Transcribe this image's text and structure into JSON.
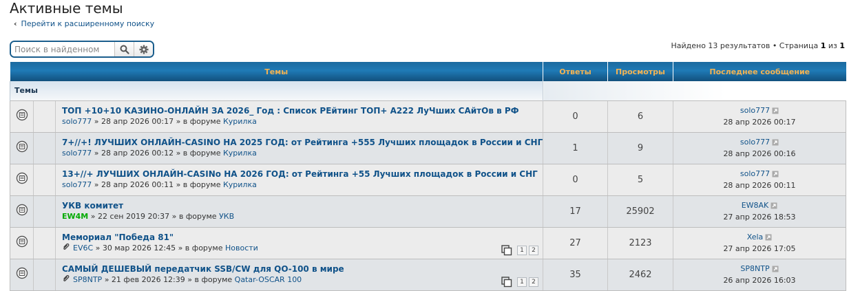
{
  "page": {
    "title": "Активные темы",
    "back_link": "Перейти к расширенному поиску",
    "search_placeholder": "Поиск в найденном",
    "results_prefix": "Найдено 13 результатов • Страница ",
    "page_current": "1",
    "page_of": " из ",
    "page_total": "1"
  },
  "table": {
    "headers": {
      "topics": "Темы",
      "replies": "Ответы",
      "views": "Просмотры",
      "last_post": "Последнее сообщение"
    },
    "group_label": "Темы",
    "rows": [
      {
        "title": "ТОП +10+10 КАЗИНО-ОНЛАЙН ЗА 2026_ Год : Список РЕйтинг ТОП+ А222 ЛуЧших САйтОв в РФ",
        "author": "solo777",
        "date": " » 28 апр 2026 00:17 » в форуме ",
        "forum": "Курилка",
        "replies": "0",
        "views": "6",
        "last_author": "solo777",
        "last_date": "28 апр 2026 00:17"
      },
      {
        "title": "7+//+! ЛУЧШИХ ОНЛАЙН-CASINO НА 2025 ГОД: от Рейтинга +555 Лучших площадок в России и СНГ",
        "author": "solo777",
        "date": " » 28 апр 2026 00:12 » в форуме ",
        "forum": "Курилка",
        "replies": "1",
        "views": "9",
        "last_author": "solo777",
        "last_date": "28 апр 2026 00:16"
      },
      {
        "title": "13+//+ ЛУЧШИХ ОНЛАЙН-CASINo НА 2026 ГОД: от Рейтинга +55 Лучших площадок в России и СНГ",
        "author": "solo777",
        "date": " » 28 апр 2026 00:11 » в форуме ",
        "forum": "Курилка",
        "replies": "0",
        "views": "5",
        "last_author": "solo777",
        "last_date": "28 апр 2026 00:11"
      },
      {
        "title": "УКВ комитет",
        "author": "EW4M",
        "date": " » 22 сен 2019 20:37 » в форуме ",
        "forum": "УКВ",
        "replies": "17",
        "views": "25902",
        "last_author": "EW8AK",
        "last_date": "27 апр 2026 18:53"
      },
      {
        "title": "Мемориал \"Победа 81\"",
        "author": "EV6C",
        "date": " » 30 мар 2026 12:45 » в форуме ",
        "forum": "Новости",
        "replies": "27",
        "views": "2123",
        "last_author": "Xela",
        "last_date": "27 апр 2026 17:05",
        "pages": [
          "1",
          "2"
        ]
      },
      {
        "title": "САМЫЙ ДЕШЕВЫЙ передатчик SSB/CW для QO-100 в мире",
        "author": "SP8NTP",
        "date": " » 21 фев 2026 12:39 » в форуме ",
        "forum": "Qatar-OSCAR 100",
        "replies": "35",
        "views": "2462",
        "last_author": "SP8NTP",
        "last_date": "26 апр 2026 16:03",
        "pages": [
          "1",
          "2"
        ]
      }
    ]
  },
  "colors": {
    "header_bg": "#1b6a9f",
    "header_text": "#f3b353",
    "link": "#105289",
    "row_odd": "#ececec",
    "row_even": "#e1e4e7",
    "special_author": "#00aa00"
  },
  "icons": {
    "topic": "topic-read-icon",
    "search": "search-icon",
    "settings": "gear-icon",
    "goto": "goto-last-post-icon",
    "attachment": "paperclip-icon",
    "pages": "multi-page-icon"
  }
}
